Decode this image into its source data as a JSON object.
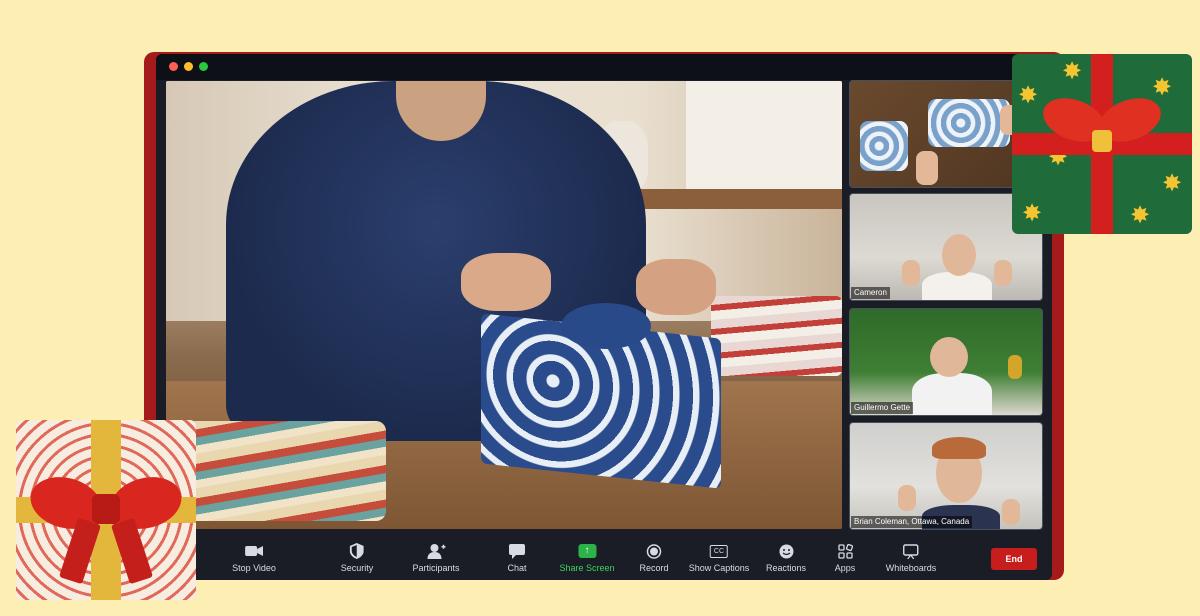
{
  "window": {
    "controls": [
      "close",
      "minimize",
      "maximize"
    ]
  },
  "participants": [
    {
      "name": ""
    },
    {
      "name": "Cameron"
    },
    {
      "name": "Guillermo Gette"
    },
    {
      "name": "Brian Coleman, Ottawa, Canada"
    }
  ],
  "toolbar": {
    "stop_video": "Stop Video",
    "security": "Security",
    "participants": "Participants",
    "chat": "Chat",
    "share_screen": "Share Screen",
    "record": "Record",
    "show_captions": "Show Captions",
    "cc": "CC",
    "reactions": "Reactions",
    "apps": "Apps",
    "whiteboards": "Whiteboards",
    "end": "End"
  },
  "colors": {
    "background": "#fdeeb4",
    "window_frame": "#a51a1a",
    "share_accent": "#3fd35d",
    "end_button": "#c81d1d"
  }
}
